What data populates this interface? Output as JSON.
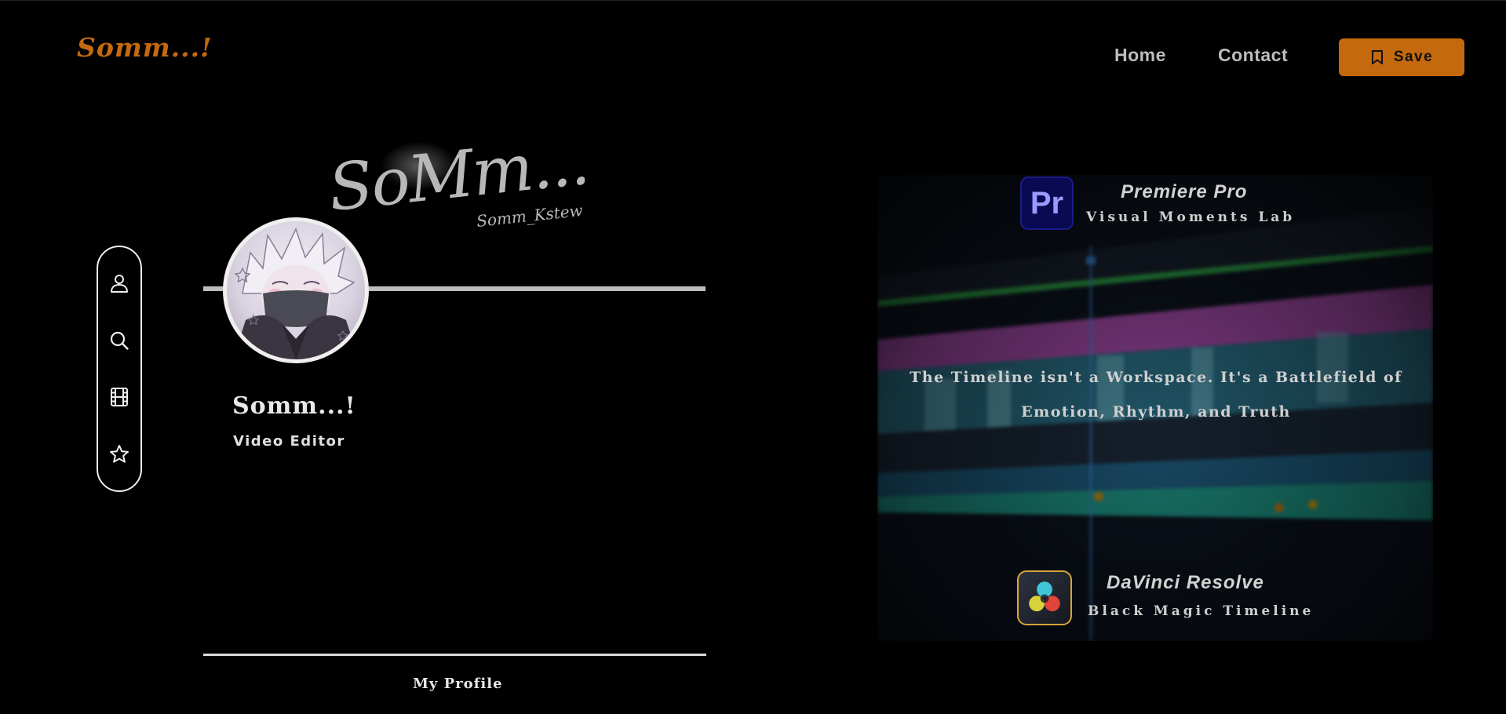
{
  "header": {
    "brand": "Somm...!",
    "nav": {
      "home": "Home",
      "contact": "Contact"
    },
    "save_label": "Save"
  },
  "sidebar": {
    "items": [
      {
        "name": "profile",
        "icon": "user-icon"
      },
      {
        "name": "search",
        "icon": "search-icon"
      },
      {
        "name": "videos",
        "icon": "film-icon"
      },
      {
        "name": "favorites",
        "icon": "star-icon"
      }
    ]
  },
  "profile": {
    "signature_logo": "SoMm...!",
    "signature_handle": "Somm_Kstew",
    "name": "Somm...!",
    "role": "Video Editor",
    "tab": "My Profile"
  },
  "showcase": {
    "premiere": {
      "icon_text": "Pr",
      "title": "Premiere Pro",
      "subtitle": "Visual Moments Lab"
    },
    "quote": "The Timeline isn't a Workspace. It's a Battlefield of Emotion, Rhythm, and Truth",
    "davinci": {
      "title": "DaVinci Resolve",
      "subtitle": "Black Magic Timeline"
    }
  },
  "colors": {
    "accent": "#c4690d",
    "background": "#000000",
    "text": "#d2d2d2",
    "premiere_bg": "#0a0a52"
  }
}
